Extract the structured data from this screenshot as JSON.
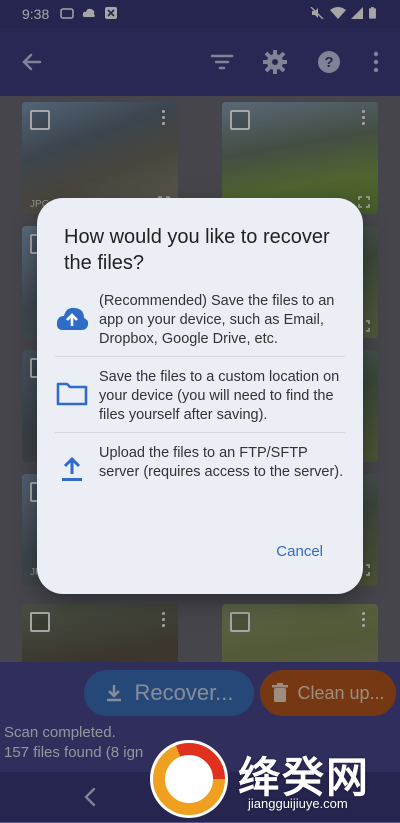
{
  "status_bar": {
    "time": "9:38"
  },
  "app_bar": {
    "icons": [
      "back-arrow-icon",
      "filter-icon",
      "gear-icon",
      "help-icon",
      "more-vert-icon"
    ]
  },
  "grid": {
    "thumbs": [
      {
        "format": "JPG"
      },
      {
        "format": ""
      },
      {
        "format": ""
      },
      {
        "format": ""
      },
      {
        "format": ""
      },
      {
        "format": ""
      },
      {
        "format": ""
      },
      {
        "format": ""
      },
      {
        "format": "JPG"
      },
      {
        "format": ""
      },
      {
        "format": ""
      },
      {
        "format": ""
      }
    ]
  },
  "dialog": {
    "title": "How would you like to recover the files?",
    "options": [
      {
        "icon": "cloud-upload-icon",
        "text": "(Recommended) Save the files to an app on your device, such as Email, Dropbox, Google Drive, etc."
      },
      {
        "icon": "folder-icon",
        "text": "Save the files to a custom location on your device (you will need to find the files yourself after saving)."
      },
      {
        "icon": "upload-icon",
        "text": "Upload the files to an FTP/SFTP server (requires access to the server)."
      }
    ],
    "cancel_label": "Cancel"
  },
  "actions": {
    "recover_label": "Recover...",
    "cleanup_label": "Clean up..."
  },
  "status": {
    "line1": "Scan completed.",
    "line2": "157 files found (8 ign"
  },
  "watermark": {
    "brand": "绛癸网",
    "url": "jiangguijiuye.com"
  },
  "colors": {
    "accent": "#2e6cc7",
    "appbar": "#3f3e82",
    "recover_button": "#3b6fb8",
    "cleanup_button": "#b5561c"
  }
}
